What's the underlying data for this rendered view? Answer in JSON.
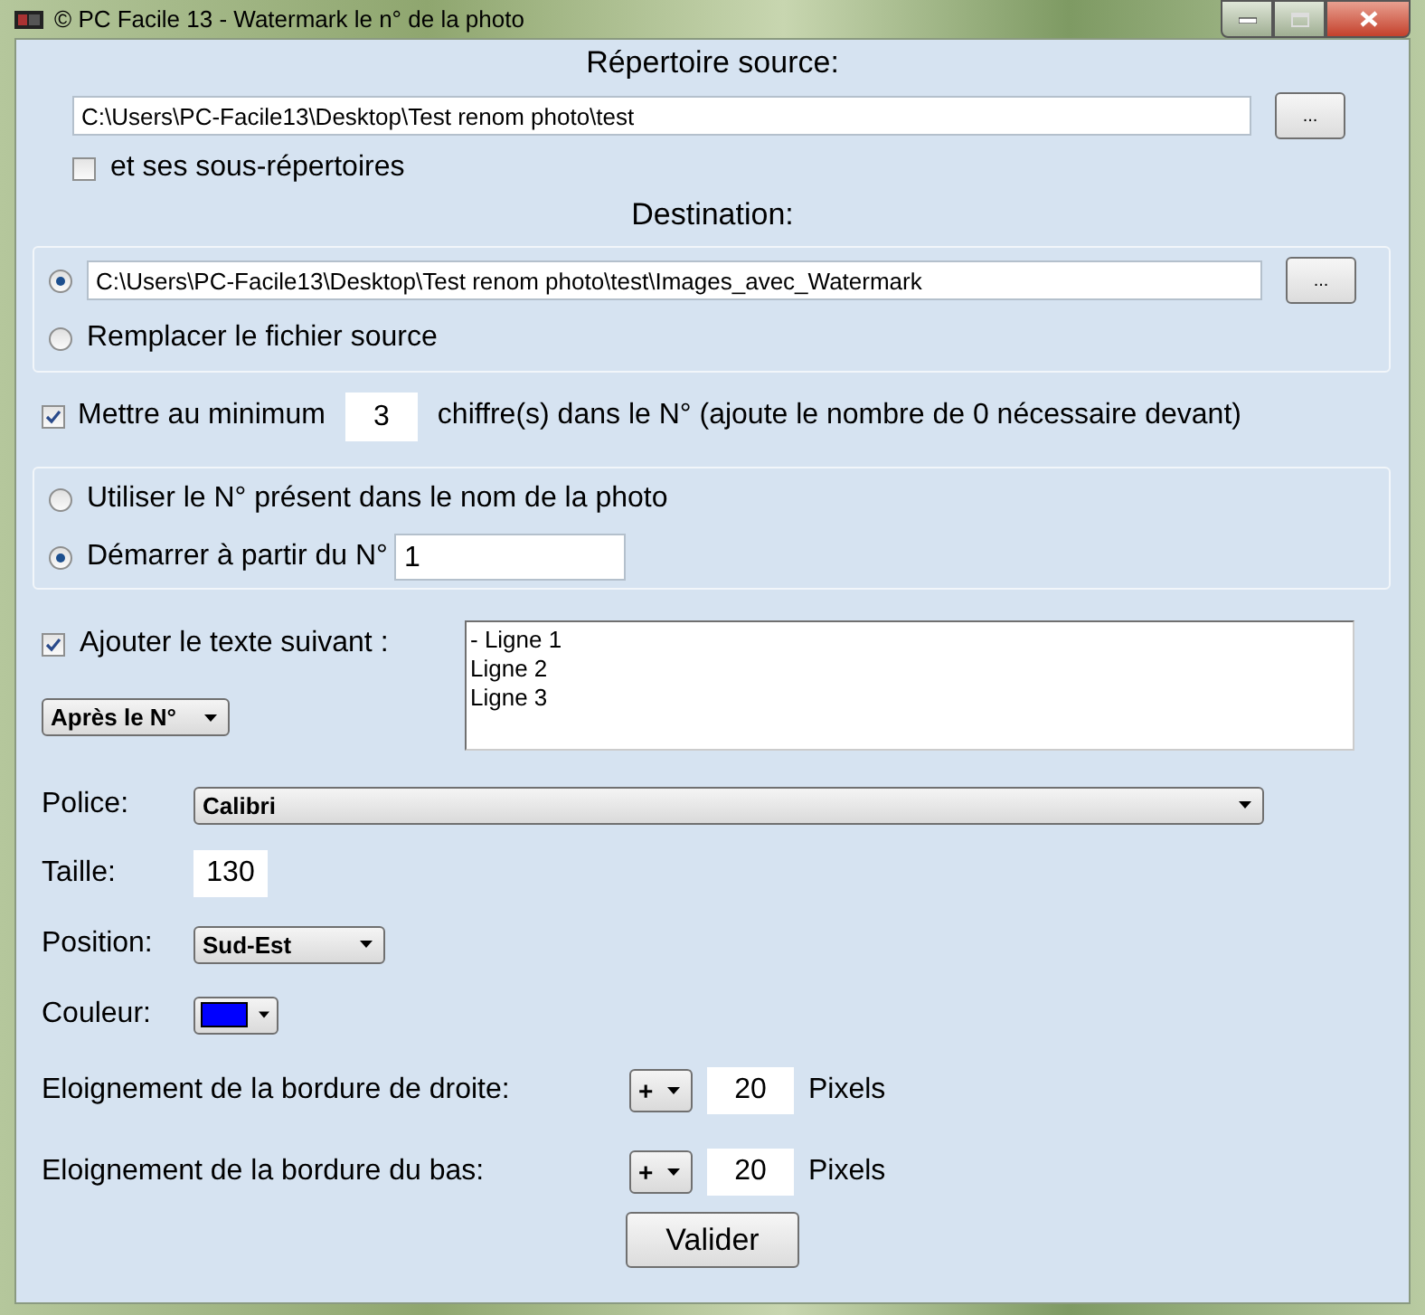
{
  "window": {
    "title": "© PC Facile 13 - Watermark le n° de la photo"
  },
  "source": {
    "heading": "Répertoire source:",
    "path": "C:\\Users\\PC-Facile13\\Desktop\\Test renom photo\\test",
    "browse": "...",
    "subfolders": {
      "label": "et ses sous-répertoires",
      "checked": false
    }
  },
  "destination": {
    "heading": "Destination:",
    "options": [
      {
        "kind": "path",
        "value": "C:\\Users\\PC-Facile13\\Desktop\\Test renom photo\\test\\Images_avec_Watermark",
        "browse": "...",
        "selected": true
      },
      {
        "kind": "label",
        "label": "Remplacer le fichier source",
        "selected": false
      }
    ]
  },
  "min_digits": {
    "checked": true,
    "label_before": "Mettre au minimum",
    "value": "3",
    "label_after": "chiffre(s) dans le N° (ajoute le nombre de 0 nécessaire devant)"
  },
  "numbering": [
    {
      "kind": "label",
      "label": "Utiliser le N° présent dans le nom de la photo",
      "selected": false
    },
    {
      "kind": "input",
      "label": "Démarrer à partir du N°",
      "value": "1",
      "selected": true
    }
  ],
  "text": {
    "checked": true,
    "label": "Ajouter le texte suivant :",
    "placement": "Après le N°",
    "lines": [
      "- Ligne 1",
      "Ligne 2",
      "Ligne 3"
    ]
  },
  "font": {
    "label": "Police:",
    "value": "Calibri"
  },
  "size": {
    "label": "Taille:",
    "value": "130"
  },
  "position": {
    "label": "Position:",
    "value": "Sud-Est"
  },
  "color": {
    "label": "Couleur:",
    "color": "#0000ff"
  },
  "offsets": [
    {
      "label": "Eloignement de la bordure de droite:",
      "sign": "+",
      "value": "20",
      "unit": "Pixels"
    },
    {
      "label": "Eloignement de la bordure du bas:",
      "sign": "+",
      "value": "20",
      "unit": "Pixels"
    }
  ],
  "submit": "Valider"
}
